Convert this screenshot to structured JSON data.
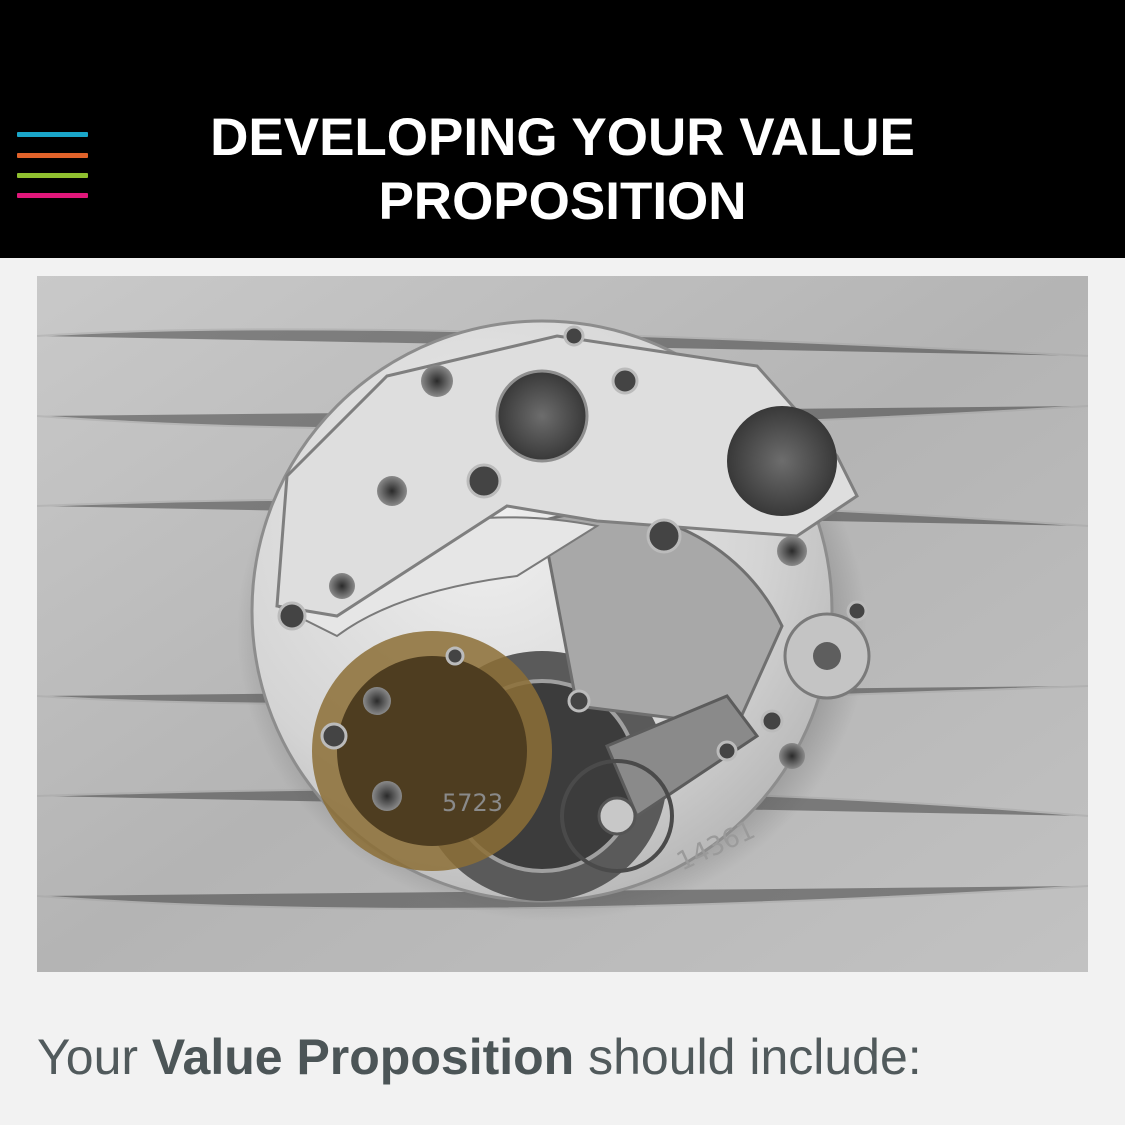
{
  "header": {
    "title": "DEVELOPING YOUR VALUE PROPOSITION",
    "menu_icon": "hamburger-menu-icon",
    "menu_colors": [
      "#1aa6c9",
      "#e0622a",
      "#8fbf2f",
      "#e0177a"
    ]
  },
  "hero": {
    "image": "watch-movement-image",
    "engraving_1": "5723",
    "engraving_2": "14361"
  },
  "content": {
    "intro_prefix": "Your ",
    "intro_bold": "Value Proposition",
    "intro_suffix": " should include:"
  },
  "colors": {
    "header_bg": "#000000",
    "page_bg": "#f2f2f2",
    "text": "#515a5c"
  }
}
